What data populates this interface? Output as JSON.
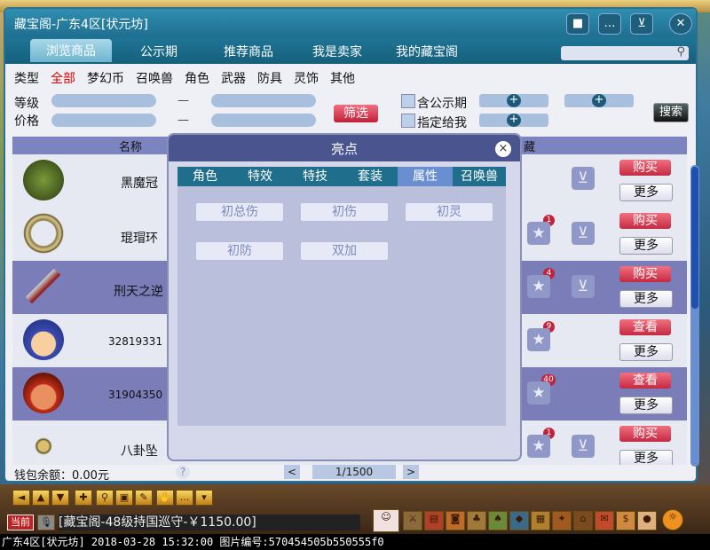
{
  "window": {
    "title": "藏宝阁-广东4区[状元坊]"
  },
  "titlebar_icons": [
    "stop-icon",
    "chat-icon",
    "cart-icon",
    "close-icon"
  ],
  "nav": [
    "浏览商品",
    "公示期",
    "推荐商品",
    "我是卖家",
    "我的藏宝阁"
  ],
  "categories": [
    "类型",
    "全部",
    "梦幻币",
    "召唤兽",
    "角色",
    "武器",
    "防具",
    "灵饰",
    "其他"
  ],
  "filters": {
    "level_label": "等级",
    "price_label": "价格",
    "dash": "—",
    "filter_button": "筛选",
    "public_period": "含公示期",
    "assign_to_me": "指定给我",
    "search_button": "搜索"
  },
  "table": {
    "headers": [
      "名称",
      "藏"
    ],
    "rows": [
      {
        "name": "黑魔冠",
        "badge": "",
        "action": "购买",
        "more": "更多"
      },
      {
        "name": "琨瑁环",
        "badge": "1",
        "action": "购买",
        "more": "更多"
      },
      {
        "name": "刑天之逆",
        "badge": "4",
        "action": "购买",
        "more": "更多"
      },
      {
        "name": "32819331",
        "badge": "9",
        "action": "查看",
        "more": "更多"
      },
      {
        "name": "31904350",
        "badge": "40",
        "action": "查看",
        "more": "更多"
      },
      {
        "name": "八卦坠",
        "badge": "1",
        "action": "购买",
        "more": "更多"
      }
    ]
  },
  "footer": {
    "wallet": "钱包余额：0.00元",
    "help": "?",
    "prev": "<",
    "page": "1/1500",
    "next": ">"
  },
  "modal": {
    "title": "亮点",
    "close": "×",
    "tabs": [
      "角色",
      "特效",
      "特技",
      "套装",
      "属性",
      "召唤兽"
    ],
    "attributes": [
      "初总伤",
      "初伤",
      "初灵",
      "初防",
      "双加"
    ]
  },
  "chat": {
    "channel": "当前",
    "message": "[藏宝阁-48级持国巡守-￥1150.00]"
  },
  "caption": "广东4区[状元坊] 2018-03-28 15:32:00 图片编号:570454505b550555f0"
}
